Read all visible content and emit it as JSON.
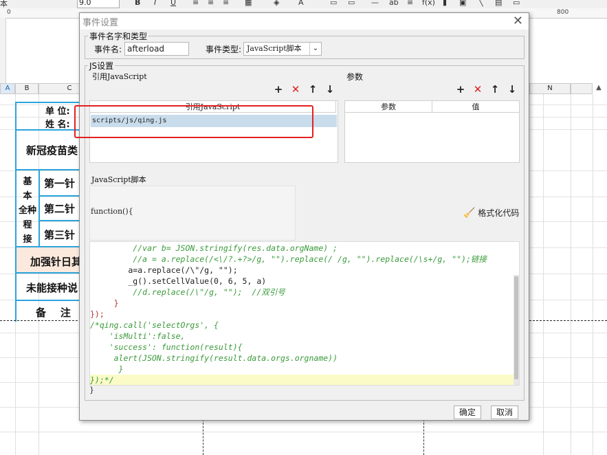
{
  "spreadsheet": {
    "toolbar_font_size": "9.0",
    "toolbar_left_text": "本",
    "ruler_marks": [
      "0",
      "800"
    ],
    "columns": [
      "A",
      "B",
      "C",
      "N"
    ],
    "cells": {
      "unit_label": "单  位:",
      "name_label": "姓  名:",
      "vaccine_type": "新冠疫苗类",
      "basic_col": "基\n本\n全种\n程\n接",
      "dose1": "第一针",
      "dose2": "第二针",
      "dose3": "第三针",
      "booster": "加强针日其",
      "not_vaccinated": "未能接种说",
      "remark": "备    注"
    }
  },
  "dialog": {
    "title": "事件设置",
    "close_glyph": "✕",
    "event_group": {
      "legend": "事件名字和类型",
      "name_label": "事件名:",
      "name_value": "afterload",
      "type_label": "事件类型:",
      "type_value": "JavaScript脚本",
      "type_arrow": "⌄"
    },
    "js_group": {
      "legend": "JS设置",
      "ref_section_label": "引用JavaScript",
      "params_section_label": "参数",
      "icons": {
        "add": "+",
        "delete": "✕",
        "up": "↑",
        "down": "↓"
      },
      "ref_table": {
        "header": "引用JavaScript",
        "rows": [
          "scripts/js/qing.js"
        ]
      },
      "params_table": {
        "headers": [
          "参数",
          "值"
        ]
      },
      "script_section_label": "JavaScript脚本",
      "function_header": "function(){",
      "format_button": "格式化代码",
      "code_lines": [
        {
          "indent": "         ",
          "text": "//var b= JSON.stringify(res.data.orgName) ;",
          "kind": "comment"
        },
        {
          "indent": "         ",
          "text": "//a = a.replace(/<\\/?.+?>/g, \"\").replace(/ /g, \"\").replace(/\\s+/g, \"\");链接",
          "kind": "comment"
        },
        {
          "indent": "        ",
          "text": "a=a.replace(/\\\"/g, \"\");",
          "kind": "code"
        },
        {
          "indent": "        ",
          "text": "_g().setCellValue(0, 6, 5, a)",
          "kind": "code"
        },
        {
          "indent": "         ",
          "text": "//d.replace(/\\\"/g, \"\");  //双引号",
          "kind": "comment"
        },
        {
          "indent": "     ",
          "text": "}",
          "kind": "brace"
        },
        {
          "indent": "",
          "text": "});",
          "kind": "brace"
        },
        {
          "indent": "",
          "text": "/*qing.call('selectOrgs', {",
          "kind": "comment"
        },
        {
          "indent": "    ",
          "text": "'isMulti':false,",
          "kind": "comment"
        },
        {
          "indent": "    ",
          "text": "'success': function(result){",
          "kind": "comment"
        },
        {
          "indent": "     ",
          "text": "alert(JSON.stringify(result.data.orgs.orgname))",
          "kind": "comment"
        },
        {
          "indent": "      ",
          "text": "}",
          "kind": "comment"
        },
        {
          "indent": "",
          "text": "});*/",
          "kind": "comment"
        }
      ],
      "closing_brace": "}"
    },
    "buttons": {
      "ok": "确定",
      "cancel": "取消"
    }
  },
  "colors": {
    "highlight_box": "#e32020",
    "selected_row": "#c9dceb",
    "cell_border": "#29a4dc"
  }
}
